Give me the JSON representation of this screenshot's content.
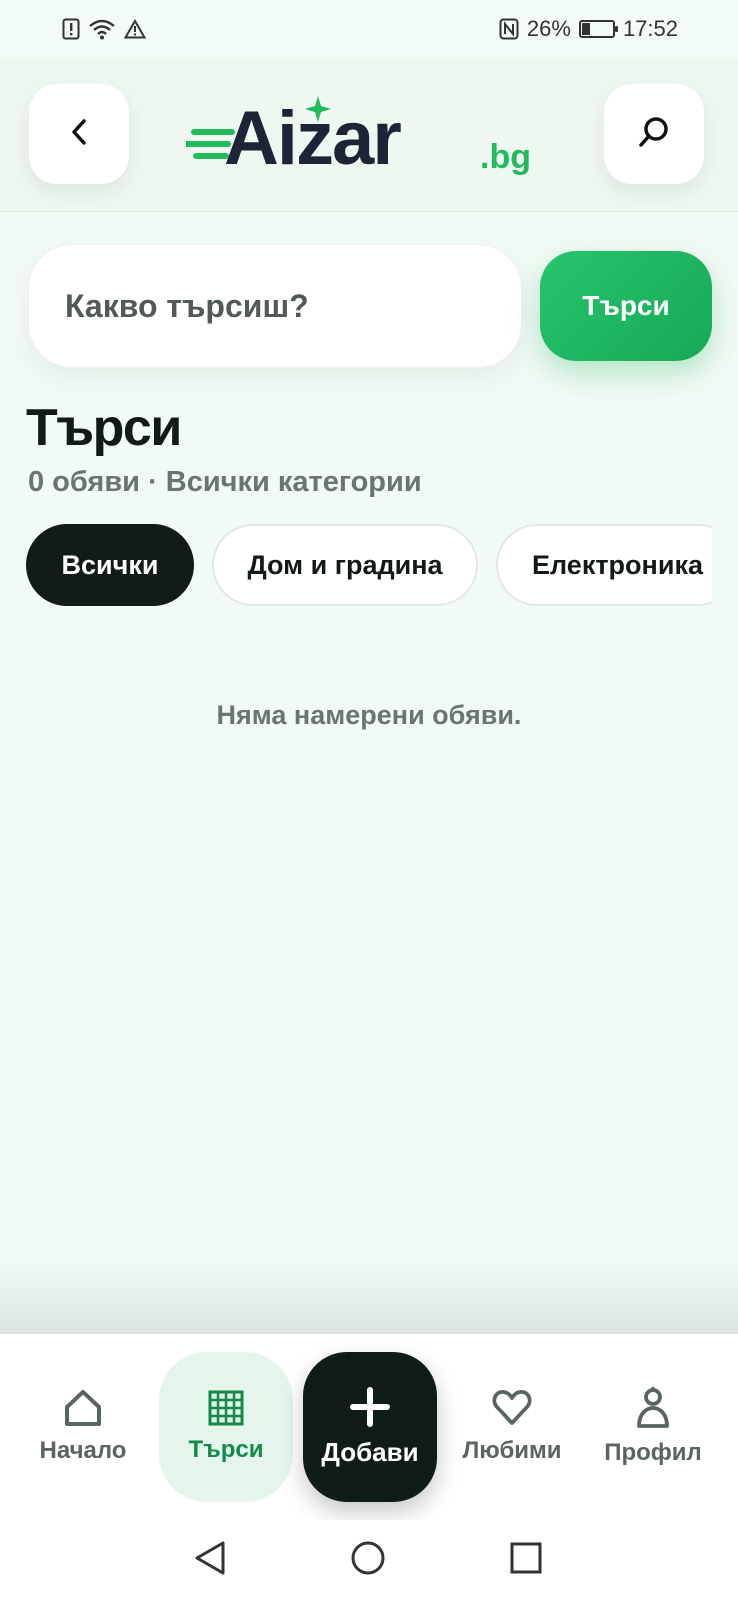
{
  "status_bar": {
    "battery_percent": "26%",
    "battery_level": 0.26,
    "time": "17:52",
    "icons": [
      "alert-card-icon",
      "wifi-icon",
      "warning-icon",
      "nfc-icon",
      "battery-icon"
    ]
  },
  "header": {
    "logo_main": "Aizar",
    "logo_suffix": ".bg",
    "back_icon": "chevron-left-icon",
    "search_icon": "search-icon"
  },
  "search": {
    "placeholder": "Какво търсиш?",
    "value": "",
    "button_label": "Търси"
  },
  "page": {
    "title": "Търси",
    "subtitle": "0 обяви · Всички категории",
    "empty_message": "Няма намерени обяви."
  },
  "categories": [
    {
      "label": "Всички",
      "active": true
    },
    {
      "label": "Дом и градина",
      "active": false
    },
    {
      "label": "Електроника",
      "active": false
    }
  ],
  "bottom_nav": {
    "home": "Начало",
    "search": "Търси",
    "add": "Добави",
    "favorites": "Любими",
    "profile": "Профил"
  },
  "colors": {
    "accent": "#1fb862",
    "dark": "#0f1c17",
    "background": "#f2faf5",
    "muted_text": "#6b7470"
  }
}
